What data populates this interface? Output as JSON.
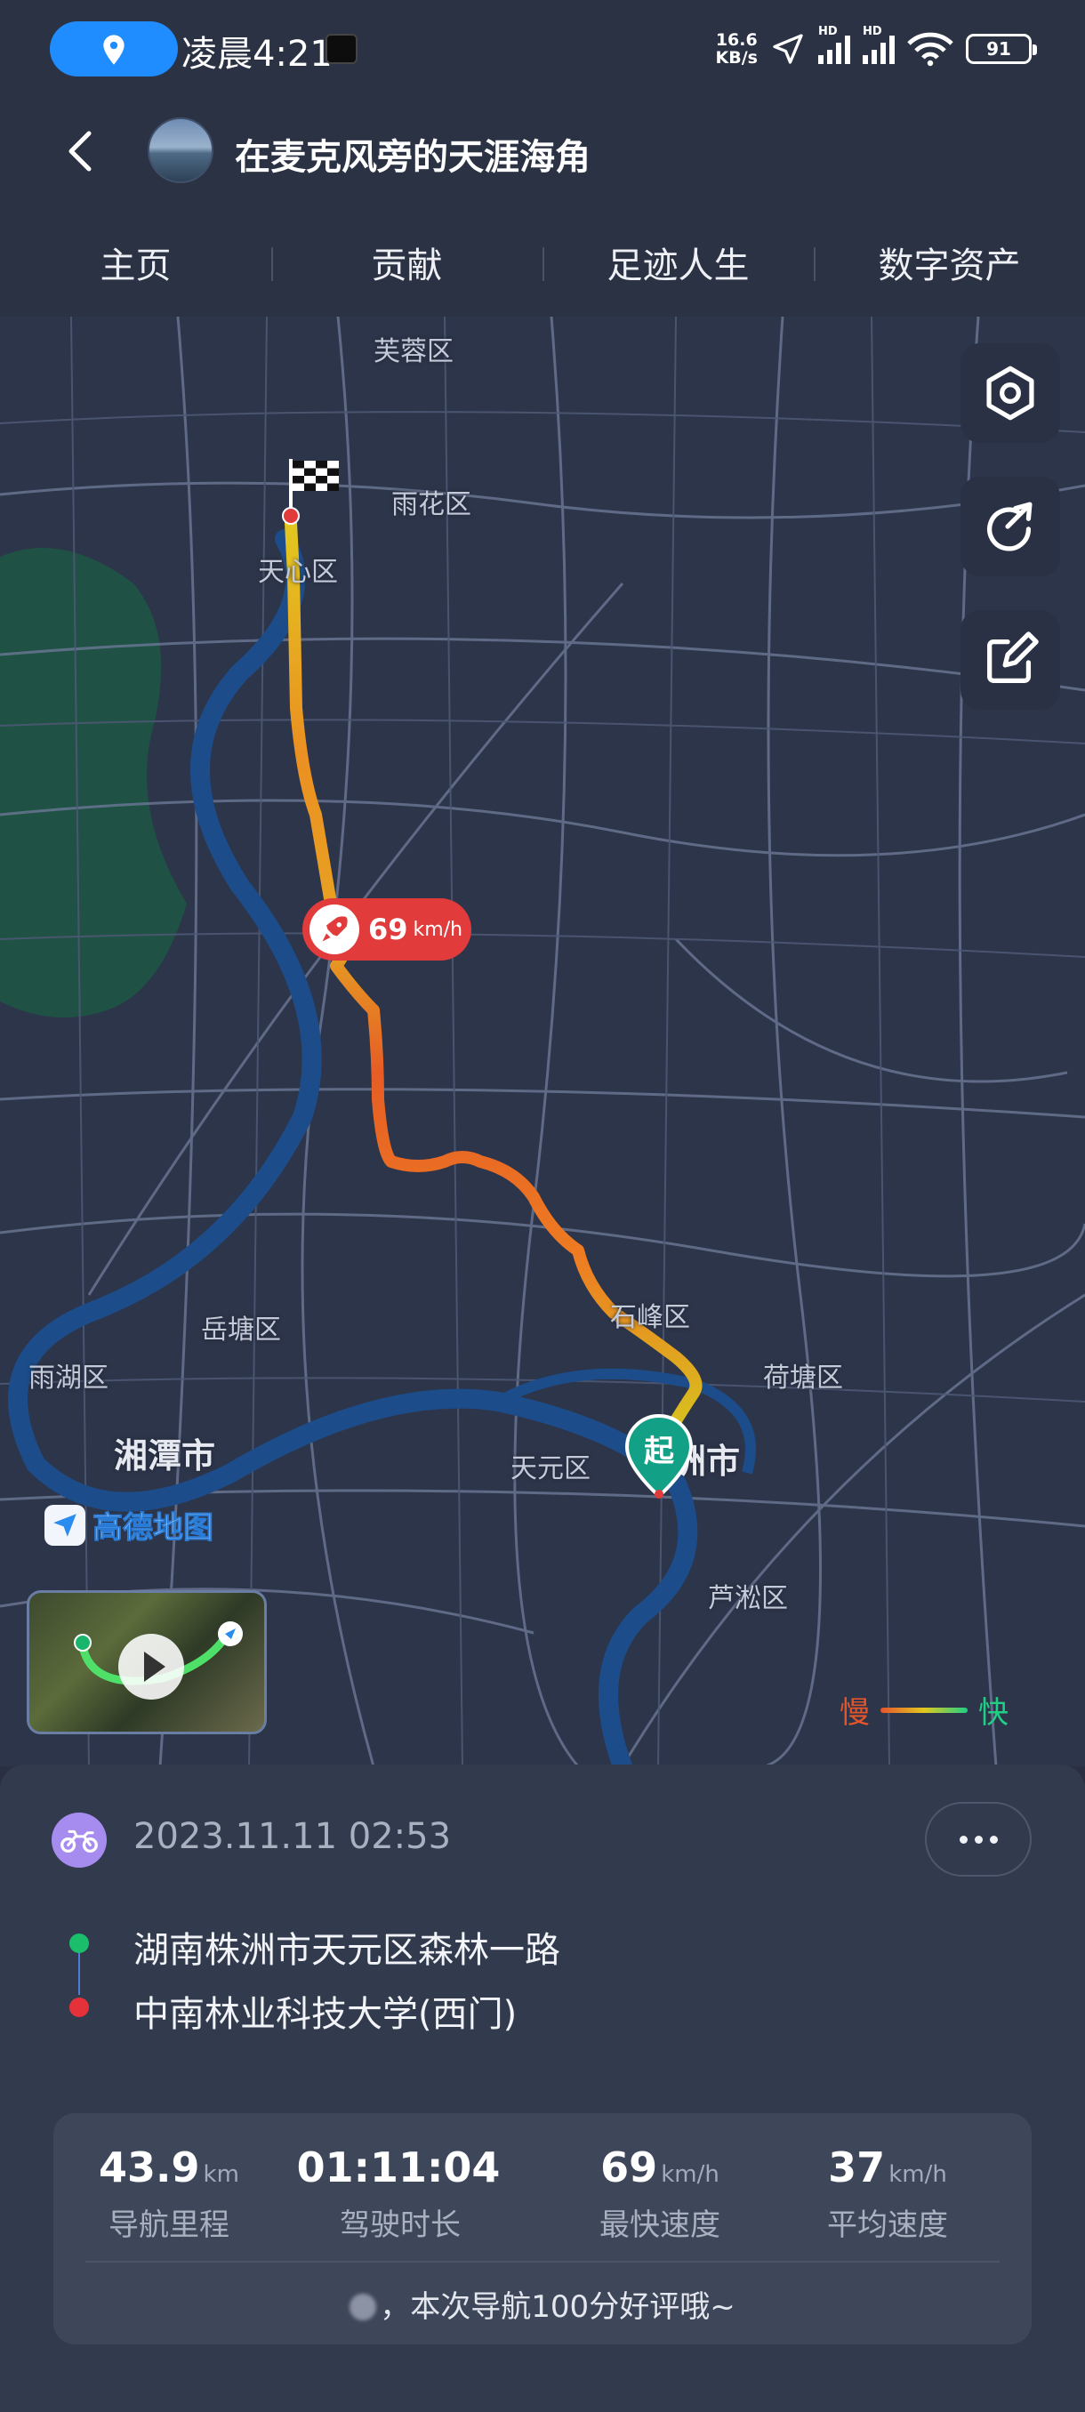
{
  "status_bar": {
    "time": "凌晨4:21",
    "net_speed": "16.6",
    "net_unit": "KB/s",
    "signal1_label": "HD",
    "signal2_label": "HD",
    "battery": "91"
  },
  "header": {
    "title": "在麦克风旁的天涯海角"
  },
  "tabs": [
    "主页",
    "贡献",
    "足迹人生",
    "数字资产"
  ],
  "map": {
    "labels": {
      "furong": "芙蓉区",
      "yuhua": "雨花区",
      "tianxin": "天心区",
      "shifeng": "石峰区",
      "yuetang": "岳塘区",
      "yuhu": "雨湖区",
      "hetang": "荷塘区",
      "xiangtan": "湘潭市",
      "tianyuan": "天元区",
      "zhuzhou": "洲市",
      "lusong": "芦淞区"
    },
    "amap_logo": "高德地图",
    "max_speed_value": "69",
    "max_speed_unit": "km/h",
    "start_marker": "起",
    "legend_slow": "慢",
    "legend_fast": "快",
    "colors": {
      "slow": "#e5552a",
      "mid": "#e2c81f",
      "fast": "#1fcf85",
      "river": "#1c4d8a",
      "park": "#1f5245",
      "road": "#6c7895"
    }
  },
  "trip": {
    "datetime": "2023.11.11 02:53",
    "start_address": "湖南株洲市天元区森林一路",
    "end_address": "中南林业科技大学(西门)",
    "stats": [
      {
        "value": "43.9",
        "unit": "km",
        "label": "导航里程"
      },
      {
        "value": "01:11:04",
        "unit": "",
        "label": "驾驶时长"
      },
      {
        "value": "69",
        "unit": "km/h",
        "label": "最快速度"
      },
      {
        "value": "37",
        "unit": "km/h",
        "label": "平均速度"
      }
    ],
    "rating_message": "，本次导航100分好评哦~"
  }
}
